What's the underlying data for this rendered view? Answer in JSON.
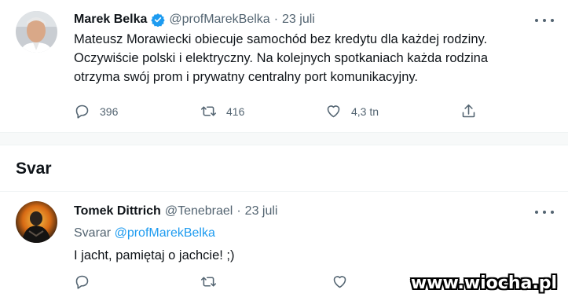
{
  "tweet1": {
    "name": "Marek Belka",
    "handle": "@profMarekBelka",
    "sep": "·",
    "date": "23 juli",
    "lines": [
      "Mateusz Morawiecki obiecuje samochód bez kredytu dla każdej rodziny.",
      "Oczywiście polski i elektryczny. Na kolejnych spotkaniach każda rodzina",
      "otrzyma swój prom i prywatny centralny port komunikacyjny."
    ],
    "replies": "396",
    "retweets": "416",
    "likes": "4,3 tn"
  },
  "section_title": "Svar",
  "tweet2": {
    "name": "Tomek Dittrich",
    "handle": "@Tenebrael",
    "sep": "·",
    "date": "23 juli",
    "reply_prefix": "Svarar",
    "reply_to": "@profMarekBelka",
    "text": "I jacht, pamiętaj o jachcie! ;)"
  },
  "watermark": "www.wiocha.pl",
  "colors": {
    "accent": "#1d9bf0",
    "muted": "#536471",
    "text": "#0f1419"
  }
}
